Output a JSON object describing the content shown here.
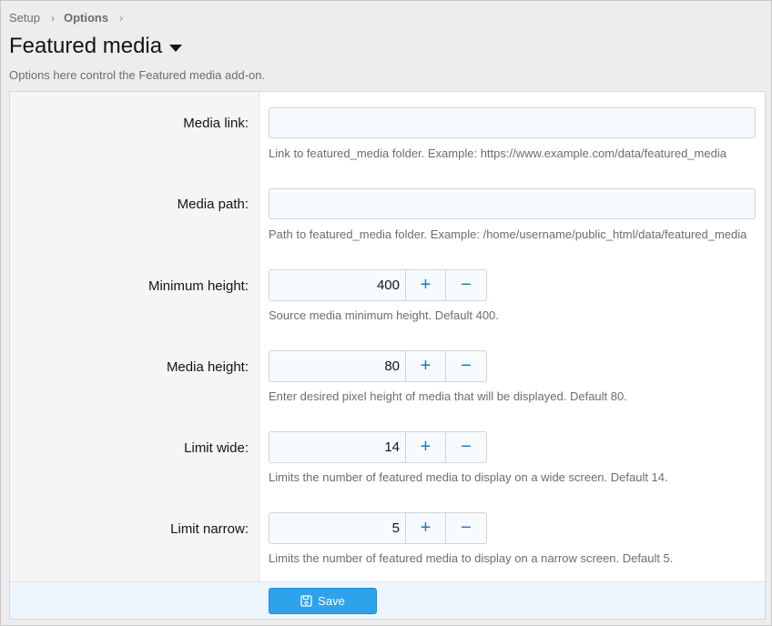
{
  "breadcrumb": [
    {
      "label": "Setup"
    },
    {
      "label": "Options"
    }
  ],
  "page": {
    "title": "Featured media",
    "description": "Options here control the Featured media add-on."
  },
  "fields": {
    "media_link": {
      "label": "Media link:",
      "value": "",
      "hint": "Link to featured_media folder. Example: https://www.example.com/data/featured_media"
    },
    "media_path": {
      "label": "Media path:",
      "value": "",
      "hint": "Path to featured_media folder. Example: /home/username/public_html/data/featured_media"
    },
    "minimum_height": {
      "label": "Minimum height:",
      "value": "400",
      "hint": "Source media minimum height. Default 400."
    },
    "media_height": {
      "label": "Media height:",
      "value": "80",
      "hint": "Enter desired pixel height of media that will be displayed. Default 80."
    },
    "limit_wide": {
      "label": "Limit wide:",
      "value": "14",
      "hint": "Limits the number of featured media to display on a wide screen. Default 14."
    },
    "limit_narrow": {
      "label": "Limit narrow:",
      "value": "5",
      "hint": "Limits the number of featured media to display on a narrow screen. Default 5."
    }
  },
  "stepper": {
    "plus": "+",
    "minus": "−"
  },
  "footer": {
    "save_label": "Save"
  },
  "icons": {
    "breadcrumb_separator": "chevron-right-icon",
    "title_menu": "caret-down-icon",
    "save": "floppy-disk-icon"
  },
  "colors": {
    "accent": "#2ea3eb",
    "stepper": "#2577b1",
    "input_bg": "#f5fbff"
  }
}
